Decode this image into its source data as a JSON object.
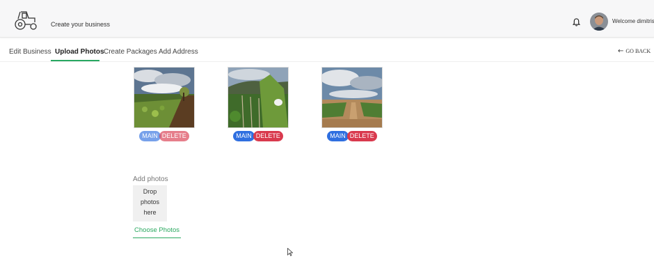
{
  "header": {
    "app_title": "Create your business",
    "welcome_text": "Welcome dimitris"
  },
  "tabs": [
    {
      "label": "Edit Business"
    },
    {
      "label": "Upload Photos",
      "active": true
    },
    {
      "label": "Create Packages"
    },
    {
      "label": "Add Address"
    }
  ],
  "go_back_label": "GO BACK",
  "photos": [
    {
      "scene": "garden-plot",
      "main_label": "MAIN",
      "delete_label": "DELETE"
    },
    {
      "scene": "vegetable-rows",
      "main_label": "MAIN",
      "delete_label": "DELETE"
    },
    {
      "scene": "crop-field",
      "main_label": "MAIN",
      "delete_label": "DELETE"
    }
  ],
  "upload": {
    "title": "Add photos",
    "dropzone_line1": "Drop photos",
    "dropzone_line2": "here",
    "choose_button": "Choose Photos"
  },
  "colors": {
    "accent_green": "#28a862",
    "main_blue": "#2f6fe0",
    "delete_red": "#d93a4e"
  },
  "icons": [
    "tractor-logo-icon",
    "bell-icon",
    "arrow-left-icon",
    "mouse-cursor-icon"
  ]
}
